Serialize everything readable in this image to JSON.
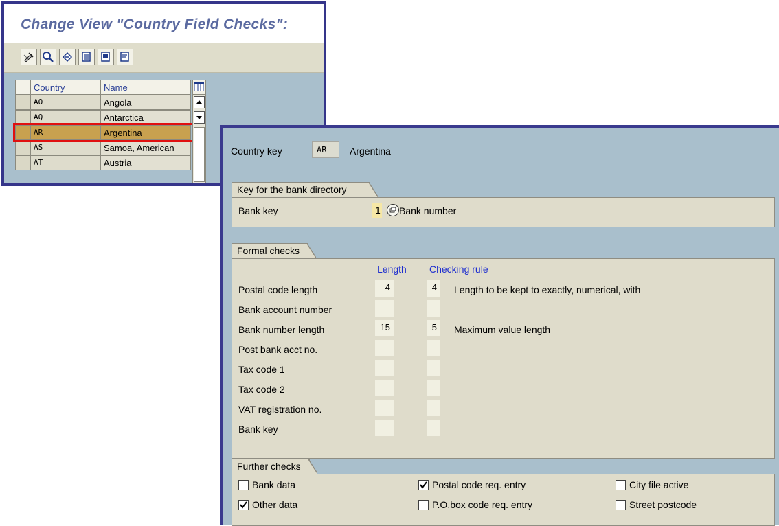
{
  "back_window": {
    "title": "Change View \"Country Field Checks\":",
    "toolbar_icons": [
      "change-display-icon",
      "details-icon",
      "undo-icon",
      "select-all-icon",
      "select-block-icon",
      "deselect-all-icon"
    ],
    "table": {
      "col_country": "Country",
      "col_name": "Name",
      "rows": [
        {
          "code": "AO",
          "name": "Angola"
        },
        {
          "code": "AQ",
          "name": "Antarctica"
        },
        {
          "code": "AR",
          "name": "Argentina"
        },
        {
          "code": "AS",
          "name": "Samoa, American"
        },
        {
          "code": "AT",
          "name": "Austria"
        }
      ]
    }
  },
  "dialog": {
    "country_key_label": "Country key",
    "country_key_value": "AR",
    "country_name": "Argentina",
    "bank_dir": {
      "section_title": "Key for the bank directory",
      "bank_key_label": "Bank key",
      "bank_key_value": "1",
      "bank_key_text": "Bank number"
    },
    "formal": {
      "section_title": "Formal checks",
      "col_length": "Length",
      "col_rule": "Checking rule",
      "rows": [
        {
          "label": "Postal code length",
          "length": "4",
          "rule": "4",
          "rule_text": "Length to be kept to exactly, numerical, with"
        },
        {
          "label": "Bank account number",
          "length": "",
          "rule": "",
          "rule_text": ""
        },
        {
          "label": "Bank number length",
          "length": "15",
          "rule": "5",
          "rule_text": "Maximum value length"
        },
        {
          "label": "Post bank acct no.",
          "length": "",
          "rule": "",
          "rule_text": ""
        },
        {
          "label": "Tax code 1",
          "length": "",
          "rule": "",
          "rule_text": ""
        },
        {
          "label": "Tax code 2",
          "length": "",
          "rule": "",
          "rule_text": ""
        },
        {
          "label": "VAT registration no.",
          "length": "",
          "rule": "",
          "rule_text": ""
        },
        {
          "label": "Bank key",
          "length": "",
          "rule": "",
          "rule_text": ""
        }
      ]
    },
    "further": {
      "section_title": "Further checks",
      "checks": [
        {
          "label": "Bank data",
          "checked": false
        },
        {
          "label": "Postal code req. entry",
          "checked": true
        },
        {
          "label": "City file active",
          "checked": false
        },
        {
          "label": "Other data",
          "checked": true
        },
        {
          "label": "P.O.box code req. entry",
          "checked": false
        },
        {
          "label": "Street postcode",
          "checked": false
        }
      ]
    }
  },
  "colors": {
    "frame": "#35358a",
    "background": "#a9bfcc",
    "panel": "#dfdccb",
    "selected_row": "#c8a14f",
    "highlight_border": "#e01010",
    "column_header": "#1f2fcf"
  }
}
